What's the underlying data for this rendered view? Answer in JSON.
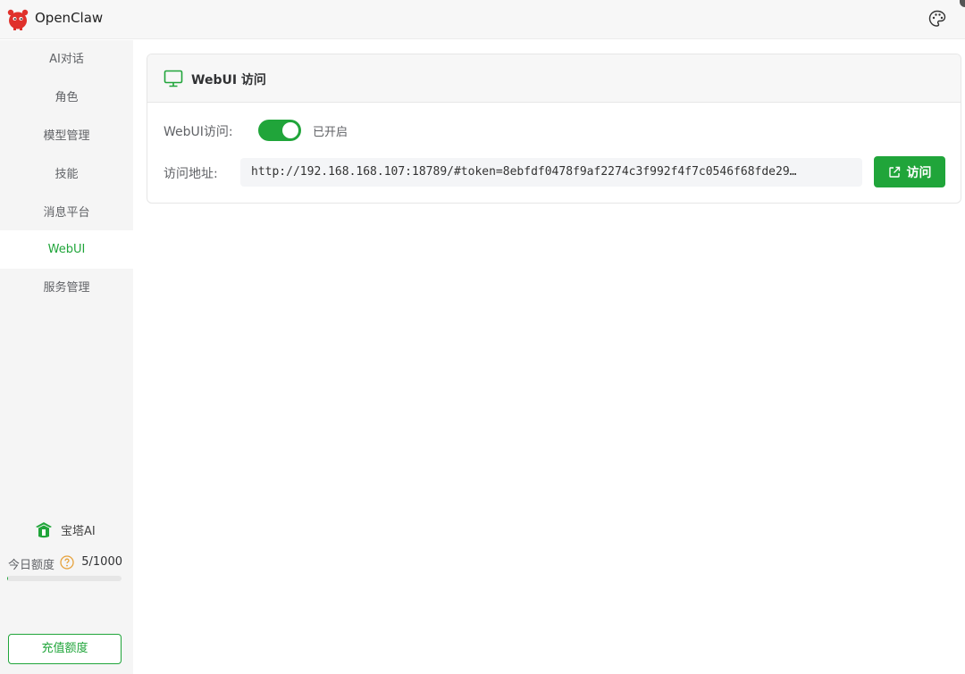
{
  "app": {
    "title": "OpenClaw",
    "logo_icon": "openclaw-logo-icon",
    "theme_icon": "palette-icon"
  },
  "colors": {
    "accent": "#20a53a",
    "sidebar_bg": "#f5f5f5",
    "header_bg": "#f7f7f7"
  },
  "sidebar": {
    "items": [
      {
        "label": "AI对话",
        "active": false
      },
      {
        "label": "角色",
        "active": false
      },
      {
        "label": "模型管理",
        "active": false
      },
      {
        "label": "技能",
        "active": false
      },
      {
        "label": "消息平台",
        "active": false
      },
      {
        "label": "WebUI",
        "active": true
      },
      {
        "label": "服务管理",
        "active": false
      }
    ],
    "brand": {
      "label": "宝塔AI",
      "icon": "baota-logo-icon"
    },
    "quota": {
      "label": "今日额度",
      "help_icon": "question-circle-icon",
      "value": "5/1000",
      "used": 5,
      "total": 1000
    },
    "recharge_label": "充值额度"
  },
  "webui_card": {
    "title": "WebUI 访问",
    "title_icon": "monitor-icon",
    "access_label": "WebUI访问:",
    "enabled": true,
    "status_text": "已开启",
    "address_label": "访问地址:",
    "url": "http://192.168.168.107:18789/#token=8ebfdf0478f9af2274c3f992f4f7c0546f68fde29…",
    "visit_label": "访问",
    "visit_icon": "external-link-icon"
  }
}
